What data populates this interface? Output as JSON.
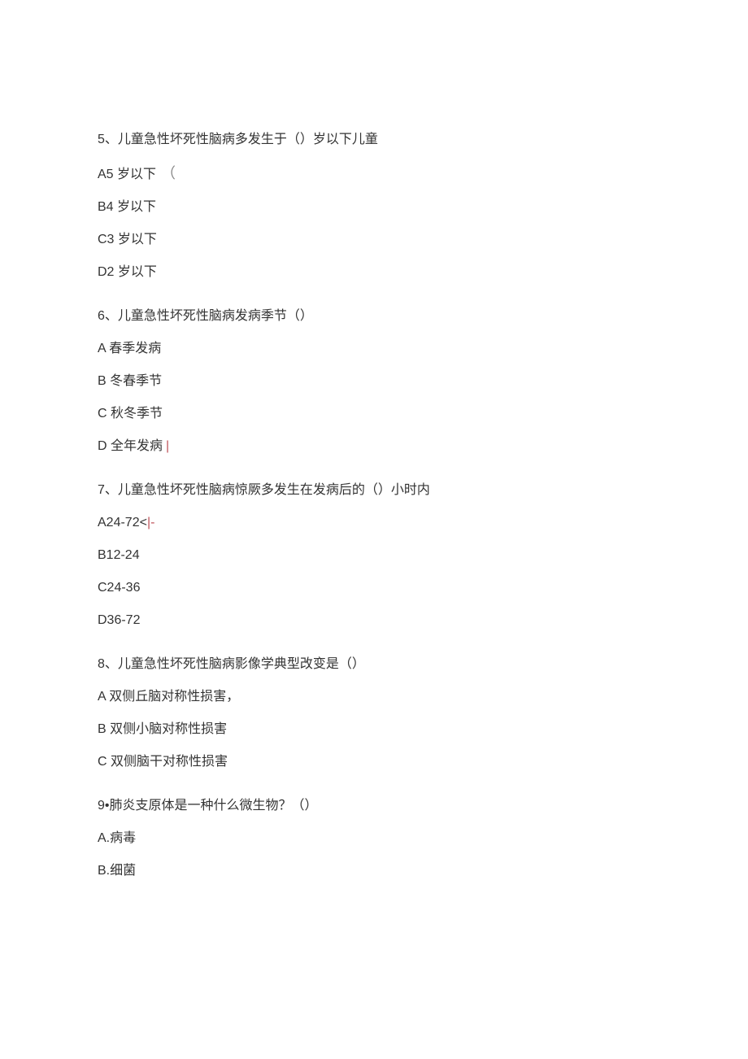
{
  "questions": [
    {
      "number": "5",
      "stem": "儿童急性坏死性脑病多发生于（）岁以下儿童",
      "options": [
        {
          "label": "A5 岁以下",
          "marker_type": "paren",
          "marker_text": "（"
        },
        {
          "label": "B4 岁以下",
          "marker_type": "none",
          "marker_text": ""
        },
        {
          "label": "C3 岁以下",
          "marker_type": "none",
          "marker_text": ""
        },
        {
          "label": "D2 岁以下",
          "marker_type": "none",
          "marker_text": ""
        }
      ]
    },
    {
      "number": "6",
      "stem": "儿童急性坏死性脑病发病季节（）",
      "options": [
        {
          "label": "A 春季发病",
          "marker_type": "none",
          "marker_text": ""
        },
        {
          "label": "B 冬春季节",
          "marker_type": "none",
          "marker_text": ""
        },
        {
          "label": "C 秋冬季节",
          "marker_type": "none",
          "marker_text": ""
        },
        {
          "label": "D 全年发病",
          "marker_type": "bar",
          "marker_text": "|"
        }
      ]
    },
    {
      "number": "7",
      "stem": "儿童急性坏死性脑病惊厥多发生在发病后的（）小时内",
      "options": [
        {
          "label": "A24-72",
          "marker_type": "ltpipe",
          "marker_text_lt": "<",
          "marker_text_pipe": "|-"
        },
        {
          "label": "B12-24",
          "marker_type": "none",
          "marker_text": ""
        },
        {
          "label": "C24-36",
          "marker_type": "none",
          "marker_text": ""
        },
        {
          "label": "D36-72",
          "marker_type": "none",
          "marker_text": ""
        }
      ]
    },
    {
      "number": "8",
      "stem": "儿童急性坏死性脑病影像学典型改变是（）",
      "options": [
        {
          "label": "A 双侧丘脑对称性损害",
          "marker_type": "comma",
          "marker_text": "，"
        },
        {
          "label": "B 双侧小脑对称性损害",
          "marker_type": "none",
          "marker_text": ""
        },
        {
          "label": "C 双侧脑干对称性损害",
          "marker_type": "none",
          "marker_text": ""
        }
      ]
    },
    {
      "number": "9",
      "stem_prefix": "9•",
      "stem": "肺炎支原体是一种什么微生物？（）",
      "options": [
        {
          "label": "A.病毒",
          "marker_type": "none",
          "marker_text": ""
        },
        {
          "label": "B.细菌",
          "marker_type": "none",
          "marker_text": ""
        }
      ]
    }
  ]
}
